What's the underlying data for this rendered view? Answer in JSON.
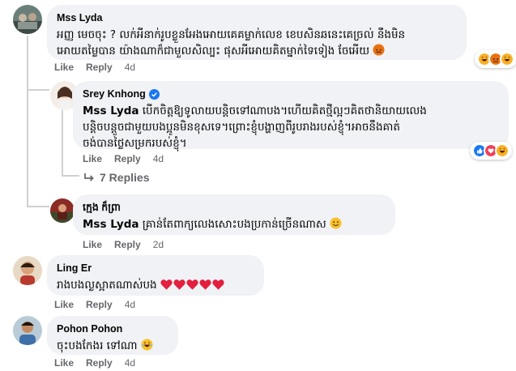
{
  "comments": [
    {
      "author": "Mss Lyda",
      "text": "អញ្ញ មេចចុះ ? លក់អីនាក់រូបខ្លួនអែងអោយគេគម្លាក់លេខ ខេបសិនឆនេះគេច្រល់ នឹងមិនអោយតម្លៃបាន យ៉ាងណាក៏ជាមួលសិល្បះ ផុសអីអោយគិតម្នាក់ទៃទៀង ចែអើយ",
      "text_line1": "អញ្ញ មេចចុះ ? លក់អីនាក់រូបខ្លួនអែងអោយគេគម្លាក់លេខ ខេបសិនឆនេះគេច្រល់ នឹងមិន",
      "text_line2": "អោយតម្លៃបាន យ៉ាងណាក៏ជាមួលសិល្បះ ផុសអីអោយគិតម្នាក់ទៃទៀង ចែអើយ",
      "like_label": "Like",
      "reply_label": "Reply",
      "age": "4d",
      "reactions": [
        "haha-emoji",
        "angry-emoji",
        "haha-emoji"
      ]
    },
    {
      "author": "Srey Knhong",
      "verified": true,
      "mention": "Mss Lyda",
      "text_line1": "បើកចិត្តឱ្យទូលាយបន្ដិចទៅណាបង។ហើយគិតថ្មីល្អៗគិតថានិយាយលេង",
      "text_line2": "បន្ដិចបន្តួចជាមួយបងប្អូនមិនខុសទេ។ព្រោះខ្ញុំបង្ហាញពីរូបរាងរបស់ខ្ញុំ។អាចនឹងគាត់",
      "text_line3": "ចង់បានថ្លៃសម្រករបស់ខ្ញុំ។",
      "like_label": "Like",
      "reply_label": "Reply",
      "age": "4d",
      "reactions": [
        "like-emoji",
        "love-emoji",
        "haha-emoji"
      ],
      "replies_label": "7 Replies"
    },
    {
      "author": "ក្មេង ក៏ព្រា",
      "mention": "Mss Lyda",
      "text": "គ្រាន់តែពាក្យលេងសោះបងប្រកាន់ច្រើនណាស",
      "like_label": "Like",
      "reply_label": "Reply",
      "age": "2d"
    },
    {
      "author": "Ling Er",
      "text": "រាងបងល្ងស្អាតណាស់បង",
      "like_label": "Like",
      "reply_label": "Reply",
      "age": "4d",
      "hearts": 5
    },
    {
      "author": "Pohon Pohon",
      "text": "ចុះបងកែងរ ទៅណា",
      "like_label": "Like",
      "reply_label": "Reply",
      "age": "4d"
    }
  ],
  "colors": {
    "bubble": "#f0f2f5",
    "muted": "#65676b",
    "verified": "#1877f2",
    "heart": "#e41e3f"
  }
}
